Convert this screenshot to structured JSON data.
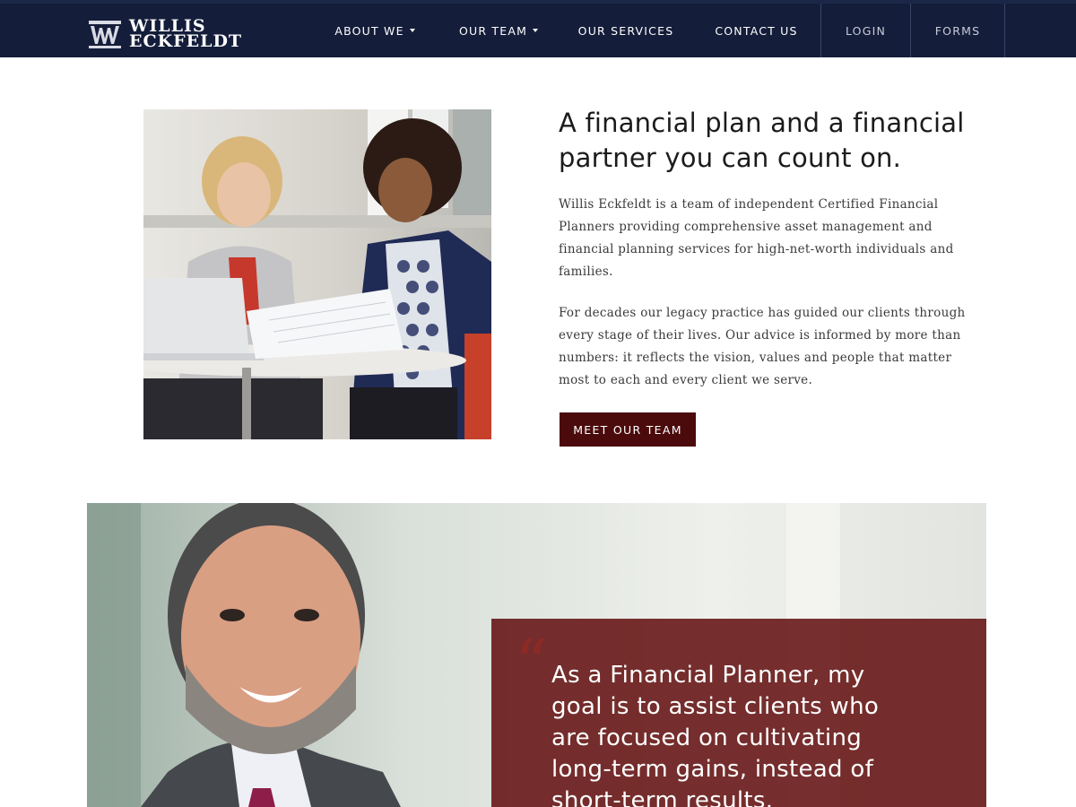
{
  "brand": {
    "line1": "WILLIS",
    "line2": "ECKFELDT",
    "navy": "#141d3a",
    "accent": "#4b0b0d"
  },
  "nav": {
    "items": [
      {
        "label": "ABOUT WE",
        "dropdown": true
      },
      {
        "label": "OUR TEAM",
        "dropdown": true
      },
      {
        "label": "OUR SERVICES",
        "dropdown": false
      },
      {
        "label": "CONTACT US",
        "dropdown": false
      },
      {
        "label": "LOGIN",
        "dropdown": false
      },
      {
        "label": "FORMS",
        "dropdown": false
      }
    ]
  },
  "hero": {
    "title": "A financial plan and a financial partner you can count on.",
    "paragraph1": "Willis Eckfeldt is a team of independent Certified Financial Planners providing comprehensive asset management and financial planning services for high-net-worth individuals and families.",
    "paragraph2": "For decades our legacy practice has guided our clients through every stage of their lives. Our advice is informed by more than numbers: it reflects the vision, values and people that matter most to each and every client we serve.",
    "cta_label": "MEET OUR TEAM"
  },
  "testimonial": {
    "quote_mark": "“",
    "quote": "As a Financial Planner, my goal is to assist clients who are focused on cultivating long-term gains, instead of short-term results."
  }
}
